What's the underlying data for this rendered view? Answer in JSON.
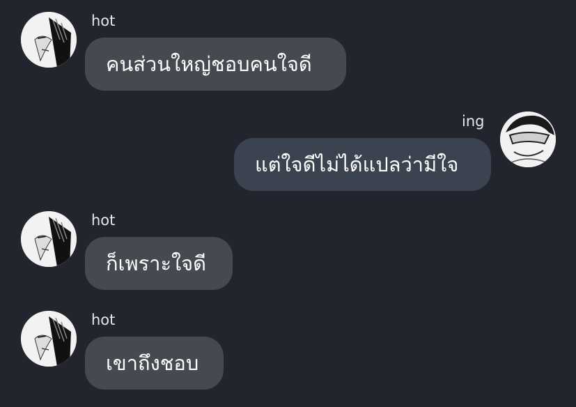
{
  "conversation": {
    "messages": [
      {
        "sender": "hot",
        "direction": "incoming",
        "text": "คนส่วนใหญ่ชอบคนใจดี",
        "avatar_icon": "anime-character-avatar-icon"
      },
      {
        "sender": "ing",
        "direction": "outgoing",
        "text": "แต่ใจดีไม่ได้แปลว่ามีใจ",
        "avatar_icon": "anime-character-glasses-avatar-icon"
      },
      {
        "sender": "hot",
        "direction": "incoming",
        "text": "ก็เพราะใจดี",
        "avatar_icon": "anime-character-avatar-icon"
      },
      {
        "sender": "hot",
        "direction": "incoming",
        "text": "เขาถึงชอบ",
        "avatar_icon": "anime-character-avatar-icon"
      }
    ]
  },
  "colors": {
    "background": "#22252d",
    "incoming_bubble": "#454950",
    "outgoing_bubble": "#3b4250",
    "text": "#ffffff",
    "sender_name": "#e6e7ea"
  }
}
